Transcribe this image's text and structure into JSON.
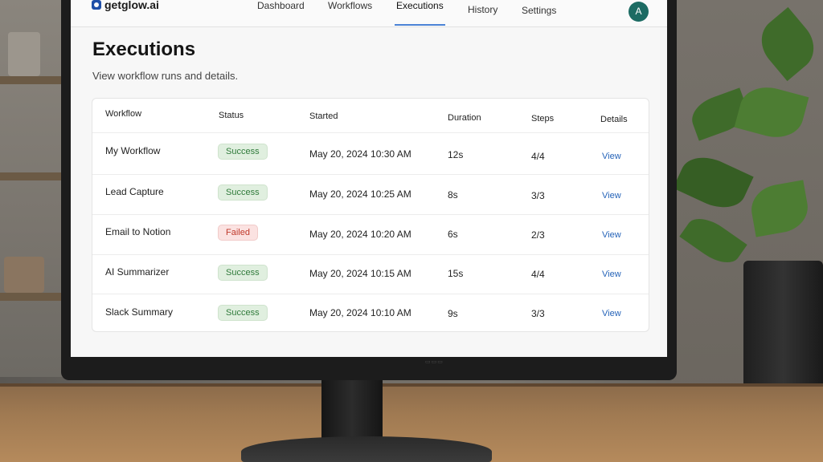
{
  "app": {
    "logo_text": "getglow.ai"
  },
  "nav": {
    "tabs": [
      {
        "label": "Dashboard"
      },
      {
        "label": "Workflows"
      },
      {
        "label": "Executions",
        "active": true
      },
      {
        "label": "History"
      },
      {
        "label": "Settings"
      }
    ],
    "avatar_initial": "A"
  },
  "page": {
    "title": "Executions",
    "subtitle": "View workflow runs and details."
  },
  "table": {
    "columns": [
      "Workflow",
      "Status",
      "Started",
      "Duration",
      "Steps",
      "Details"
    ],
    "rows": [
      {
        "workflow": "My Workflow",
        "status": "Success",
        "started": "May 20, 2024 10:30 AM",
        "duration": "12s",
        "steps": "4/4",
        "details": "View"
      },
      {
        "workflow": "Lead Capture",
        "status": "Success",
        "started": "May 20, 2024 10:25 AM",
        "duration": "8s",
        "steps": "3/3",
        "details": "View"
      },
      {
        "workflow": "Email to Notion",
        "status": "Failed",
        "started": "May 20, 2024 10:20 AM",
        "duration": "6s",
        "steps": "2/3",
        "details": "View"
      },
      {
        "workflow": "AI Summarizer",
        "status": "Success",
        "started": "May 20, 2024 10:15 AM",
        "duration": "15s",
        "steps": "4/4",
        "details": "View"
      },
      {
        "workflow": "Slack Summary",
        "status": "Success",
        "started": "May 20, 2024 10:10 AM",
        "duration": "9s",
        "steps": "3/3",
        "details": "View"
      }
    ]
  },
  "colors": {
    "accent": "#4b83d6",
    "avatar": "#1c6b63",
    "success": "#2f7a3a",
    "failed": "#c0392b",
    "link": "#2563b8"
  },
  "icons": {
    "logo": "shield-logo-icon"
  }
}
